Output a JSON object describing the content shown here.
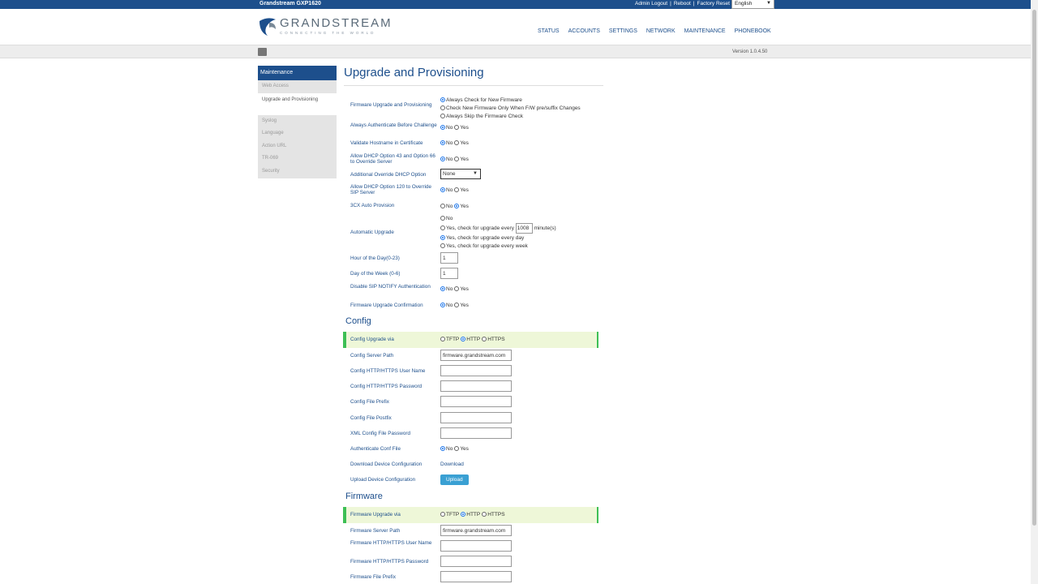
{
  "topbar": {
    "model": "Grandstream GXP1620",
    "admin_logout": "Admin Logout",
    "reboot": "Reboot",
    "factory_reset": "Factory Reset",
    "language": "English"
  },
  "logo": {
    "wordmark": "GRANDSTREAM",
    "tagline": "CONNECTING THE WORLD"
  },
  "nav": [
    "STATUS",
    "ACCOUNTS",
    "SETTINGS",
    "NETWORK",
    "MAINTENANCE",
    "PHONEBOOK"
  ],
  "version": "Version 1.0.4.50",
  "sidebar": {
    "head": "Maintenance",
    "items": [
      "Web Access",
      "Upgrade and Provisioning",
      "Syslog",
      "Language",
      "Action URL",
      "TR-069",
      "Security"
    ]
  },
  "page_title": "Upgrade and Provisioning",
  "common": {
    "no": "No",
    "yes": "Yes",
    "tftp": "TFTP",
    "http": "HTTP",
    "https": "HTTPS"
  },
  "fields": {
    "fw_upgrade": {
      "label": "Firmware Upgrade and Provisioning",
      "opt1": "Always Check for New Firmware",
      "opt2": "Check New Firmware Only When F/W pre/suffix Changes",
      "opt3": "Always Skip the Firmware Check"
    },
    "auth_before": {
      "label": "Always Authenticate Before Challenge"
    },
    "validate_host": {
      "label": "Validate Hostname in Certificate"
    },
    "dhcp43": {
      "label": "Allow DHCP Option 43 and Option 66 to Override Server"
    },
    "addl_dhcp": {
      "label": "Additional Override DHCP Option",
      "value": "None"
    },
    "dhcp120": {
      "label": "Allow DHCP Option 120 to Override SIP Server"
    },
    "cx_auto": {
      "label": "3CX Auto Provision"
    },
    "auto_upgrade": {
      "label": "Automatic Upgrade",
      "opt1": "No",
      "opt2_pre": "Yes, check for upgrade every",
      "opt2_value": "1008",
      "opt2_post": "minute(s)",
      "opt3": "Yes, check for upgrade every day",
      "opt4": "Yes, check for upgrade every week"
    },
    "hour": {
      "label": "Hour of the Day(0-23)",
      "value": "1"
    },
    "dow": {
      "label": "Day of the Week (0-6)",
      "value": "1"
    },
    "sip_notify": {
      "label": "Disable SIP NOTIFY Authentication"
    },
    "fw_confirm": {
      "label": "Firmware Upgrade Confirmation"
    }
  },
  "config": {
    "title": "Config",
    "upgrade_via": "Config Upgrade via",
    "server_path": {
      "label": "Config Server Path",
      "value": "firmware.grandstream.com"
    },
    "user": "Config HTTP/HTTPS User Name",
    "password": "Config HTTP/HTTPS Password",
    "prefix": "Config File Prefix",
    "postfix": "Config File Postfix",
    "xml_pwd": "XML Config File Password",
    "auth_conf": "Authenticate Conf File",
    "download_label": "Download Device Configuration",
    "download_link": "Download",
    "upload_label": "Upload Device Configuration",
    "upload_btn": "Upload"
  },
  "firmware": {
    "title": "Firmware",
    "upgrade_via": "Firmware Upgrade via",
    "server_path": {
      "label": "Firmware Server Path",
      "value": "firmware.grandstream.com"
    },
    "user": "Firmware HTTP/HTTPS User Name",
    "password": "Firmware HTTP/HTTPS Password",
    "prefix": "Firmware File Prefix"
  },
  "colors": {
    "brand": "#1d4f8c",
    "highlight_bg": "#eef7d8",
    "highlight_border": "#3dbf55",
    "button": "#3aa0d3"
  }
}
